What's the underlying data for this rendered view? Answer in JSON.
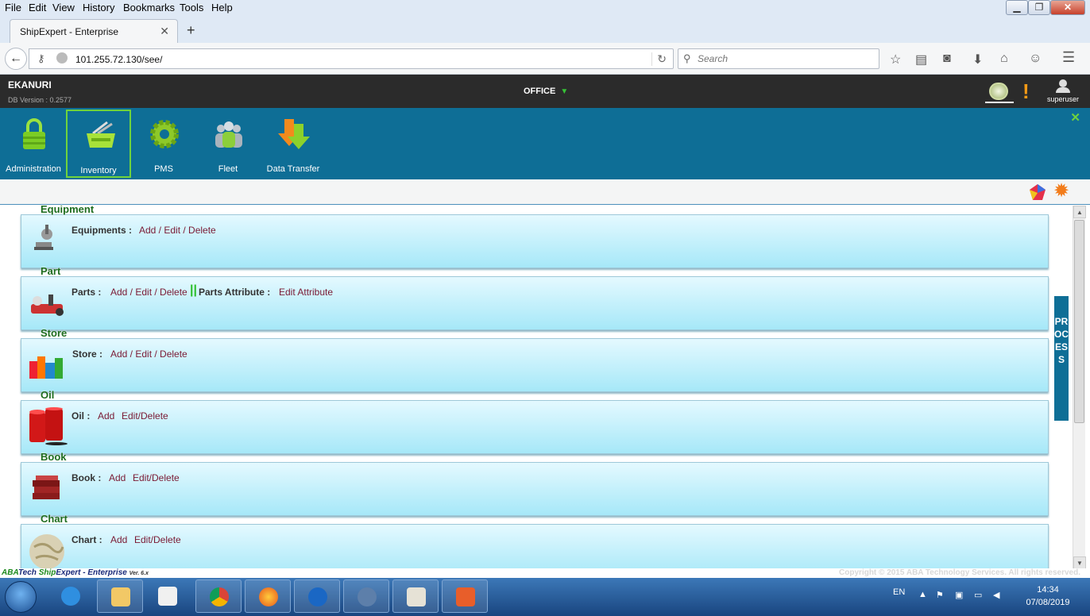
{
  "browser": {
    "menu": [
      "File",
      "Edit",
      "View",
      "History",
      "Bookmarks",
      "Tools",
      "Help"
    ],
    "tab_title": "ShipExpert - Enterprise",
    "url": "101.255.72.130/see/",
    "search_placeholder": "Search"
  },
  "app": {
    "vessel_name": "EKANURI",
    "db_version": "DB Version : 0.2577",
    "office_label": "OFFICE",
    "user_name": "superuser",
    "modules": [
      {
        "label": "Administration",
        "icon": "lock-icon",
        "active": false
      },
      {
        "label": "Inventory",
        "icon": "basket-icon",
        "active": true
      },
      {
        "label": "PMS",
        "icon": "gear-icon",
        "active": false
      },
      {
        "label": "Fleet",
        "icon": "people-icon",
        "active": false
      },
      {
        "label": "Data Transfer",
        "icon": "arrows-icon",
        "active": false
      }
    ],
    "process_tab": "PROCESS"
  },
  "panels": {
    "equipment": {
      "title": "Equipment",
      "label": "Equipments :",
      "link1": "Add / Edit / Delete"
    },
    "part": {
      "title": "Part",
      "label": "Parts :",
      "link1": "Add / Edit / Delete",
      "label2": "Parts Attribute :",
      "link2": "Edit Attribute"
    },
    "store": {
      "title": "Store",
      "label": "Store :",
      "link1": "Add / Edit / Delete"
    },
    "oil": {
      "title": "Oil",
      "label": "Oil :",
      "link1": "Add",
      "link2": "Edit/Delete"
    },
    "book": {
      "title": "Book",
      "label": "Book :",
      "link1": "Add",
      "link2": "Edit/Delete"
    },
    "chart": {
      "title": "Chart",
      "label": "Chart :",
      "link1": "Add",
      "link2": "Edit/Delete"
    }
  },
  "footer": {
    "brand_aba": "ABA",
    "brand_tech": "Tech ",
    "brand_ship": "Ship",
    "brand_rest": "Expert - Enterprise",
    "brand_ver": "Ver. 6.x",
    "copyright": "Copyright © 2015 ABA Technology Services. All rights reserved."
  },
  "taskbar": {
    "lang": "EN",
    "time": "14:34",
    "date": "07/08/2019"
  },
  "colors": {
    "module_bar": "#0e6e96",
    "panel_title": "#1f6d1f",
    "link": "#7a1a33",
    "active_outline": "#6fd33c"
  }
}
